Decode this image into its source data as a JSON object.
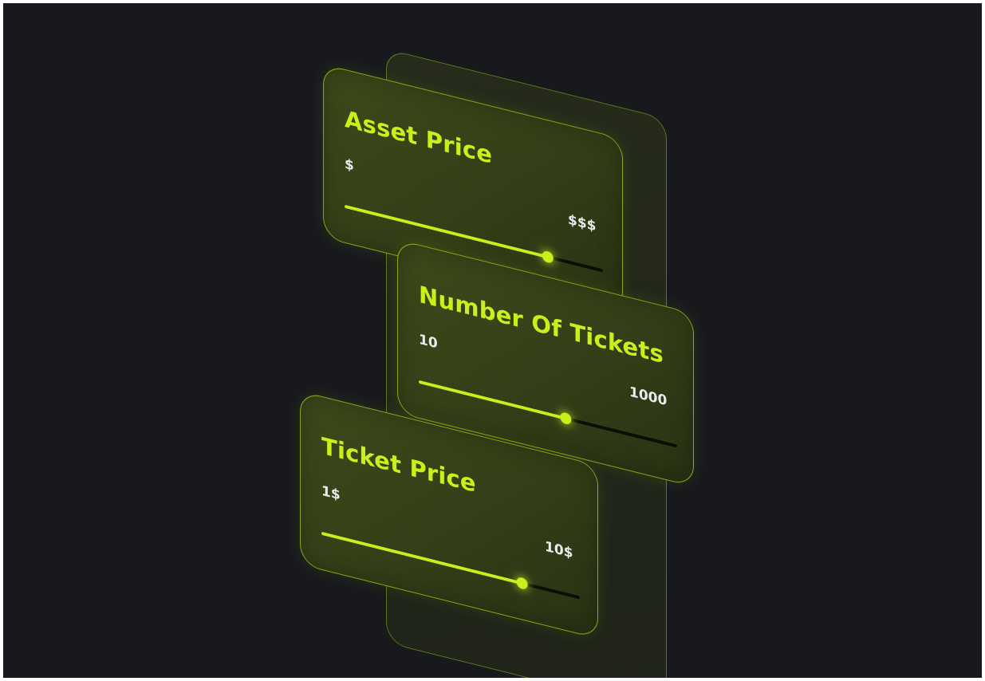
{
  "cards": [
    {
      "title": "Asset Price",
      "min_label": "$",
      "max_label": "$$$",
      "value_fraction": 0.79
    },
    {
      "title": "Number Of Tickets",
      "min_label": "10",
      "max_label": "1000",
      "value_fraction": 0.57
    },
    {
      "title": "Ticket Price",
      "min_label": "1$",
      "max_label": "10$",
      "value_fraction": 0.78
    }
  ],
  "colors": {
    "background": "#18191d",
    "accent": "#c8f01b",
    "label": "#ececec",
    "track_empty": "#0c0e06"
  }
}
